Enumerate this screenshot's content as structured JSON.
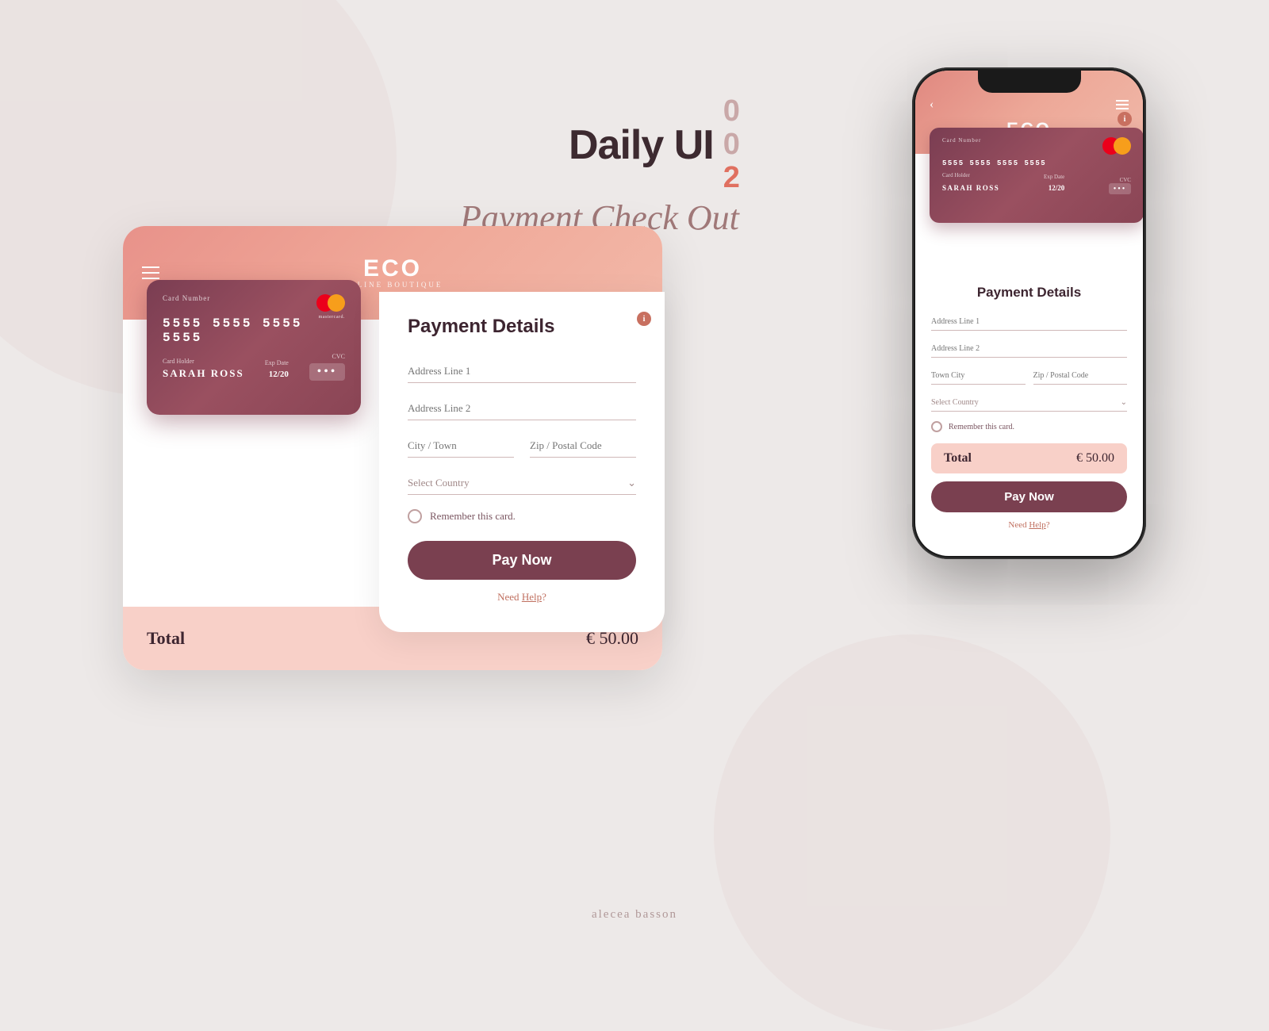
{
  "page": {
    "background_color": "#ede9e8"
  },
  "title": {
    "daily_ui": "Daily UI",
    "numbers": [
      "0",
      "0",
      "2"
    ],
    "subtitle": "Payment Check Out"
  },
  "logo": {
    "eco": "ECO",
    "boutique": "ONLINE BOUTIQUE"
  },
  "credit_card": {
    "number_label": "Card Number",
    "number": "5555  5555  5555  5555",
    "exp_label": "Exp Date",
    "exp_value": "12/20",
    "holder_label": "Card Holder",
    "holder_name": "SARAH  ROSS",
    "cvc_label": "CVC",
    "cvc_dots": "•••"
  },
  "desktop": {
    "payment_title": "Payment Details",
    "address1_placeholder": "Address Line 1",
    "address2_placeholder": "Address Line 2",
    "city_placeholder": "City / Town",
    "zip_placeholder": "Zip / Postal Code",
    "country_placeholder": "Select Country",
    "remember_text": "Remember this card.",
    "pay_button": "Pay Now",
    "need_help": "Need ",
    "help_link": "Help",
    "need_help_suffix": "?",
    "total_label": "Total",
    "total_amount": "€ 50.00"
  },
  "mobile": {
    "payment_title": "Payment Details",
    "address1_placeholder": "Address Line 1",
    "address2_placeholder": "Address Line 2",
    "city_placeholder": "Town City",
    "zip_placeholder": "Zip / Postal Code",
    "country_placeholder": "Select Country",
    "remember_text": "Remember this card.",
    "pay_button": "Pay Now",
    "need_help": "Need ",
    "help_link": "Help",
    "need_help_suffix": "?",
    "total_label": "Total",
    "total_amount": "€ 50.00"
  },
  "footer": {
    "credit": "alecea basson"
  }
}
